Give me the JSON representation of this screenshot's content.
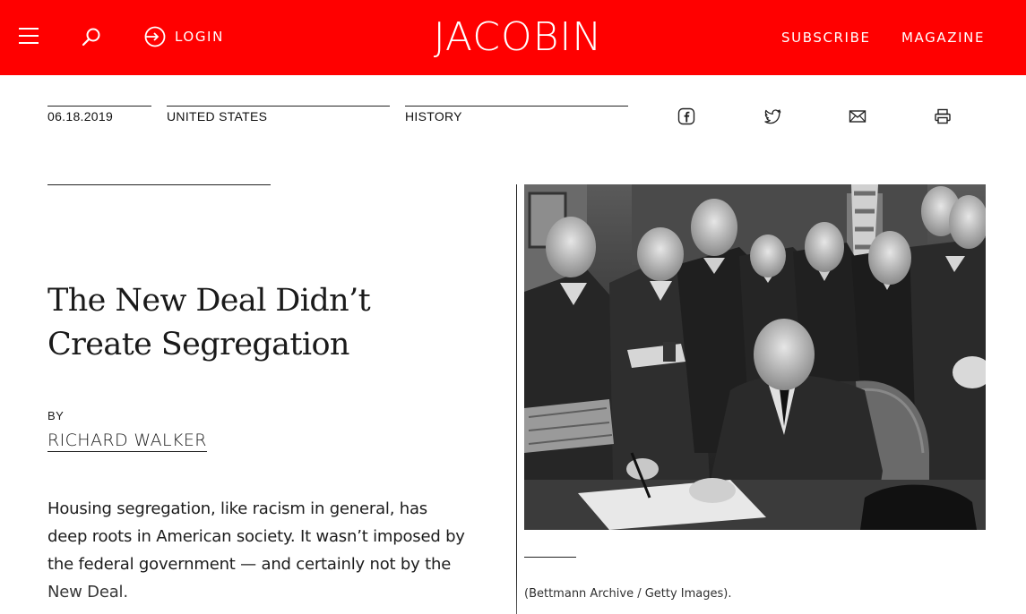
{
  "header": {
    "logo": "JACOBIN",
    "login_label": "LOGIN",
    "subscribe_label": "SUBSCRIBE",
    "magazine_label": "MAGAZINE",
    "bg_color": "#ff0000",
    "icons": [
      "menu-icon",
      "search-icon",
      "login-icon"
    ]
  },
  "meta": {
    "date": "06.18.2019",
    "region": "UNITED STATES",
    "topic": "HISTORY"
  },
  "share": [
    "facebook-icon",
    "twitter-icon",
    "mail-icon",
    "print-icon"
  ],
  "article": {
    "title": "The New Deal Didn’t Create Segregation",
    "by_label": "BY",
    "author": "RICHARD WALKER",
    "lede": "Housing segregation, like racism in general, has deep roots in American society. It wasn’t imposed by the federal government — and certainly not by the New Deal."
  },
  "image": {
    "caption": "(Bettmann Archive / Getty Images)."
  }
}
